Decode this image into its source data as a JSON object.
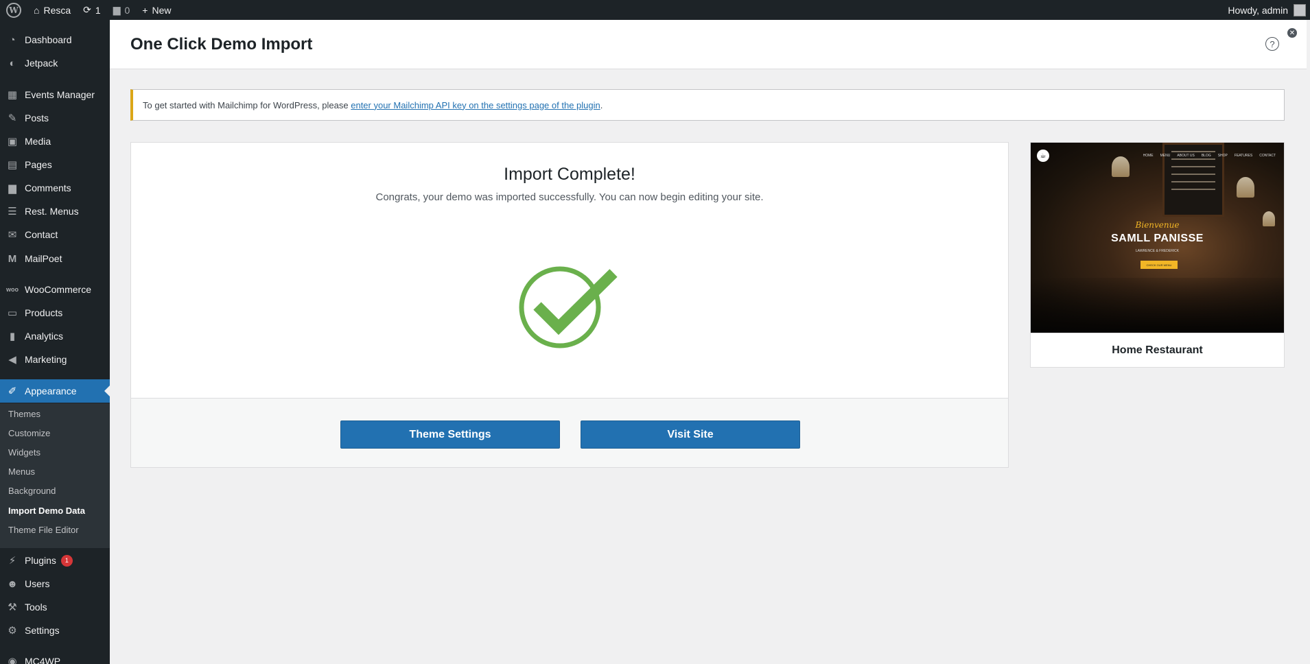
{
  "adminbar": {
    "site_name": "Resca",
    "updates_count": "1",
    "comments_count": "0",
    "new_label": "New",
    "greeting": "Howdy, admin"
  },
  "sidebar": {
    "items": [
      {
        "label": "Dashboard",
        "icon": "dashboard-icon"
      },
      {
        "label": "Jetpack",
        "icon": "jetpack-icon"
      },
      {
        "label": "Events Manager",
        "icon": "calendar-icon"
      },
      {
        "label": "Posts",
        "icon": "pin-icon"
      },
      {
        "label": "Media",
        "icon": "media-icon"
      },
      {
        "label": "Pages",
        "icon": "pages-icon"
      },
      {
        "label": "Comments",
        "icon": "comment-icon"
      },
      {
        "label": "Rest. Menus",
        "icon": "list-icon"
      },
      {
        "label": "Contact",
        "icon": "mail-icon"
      },
      {
        "label": "MailPoet",
        "icon": "mailpoet-icon"
      },
      {
        "label": "WooCommerce",
        "icon": "woo-icon"
      },
      {
        "label": "Products",
        "icon": "archive-icon"
      },
      {
        "label": "Analytics",
        "icon": "bar-chart-icon"
      },
      {
        "label": "Marketing",
        "icon": "megaphone-icon"
      },
      {
        "label": "Appearance",
        "icon": "brush-icon"
      },
      {
        "label": "Plugins",
        "icon": "plug-icon",
        "badge": "1"
      },
      {
        "label": "Users",
        "icon": "user-icon"
      },
      {
        "label": "Tools",
        "icon": "wrench-icon"
      },
      {
        "label": "Settings",
        "icon": "settings-icon"
      },
      {
        "label": "MC4WP",
        "icon": "mc4wp-icon"
      }
    ],
    "submenu": [
      "Themes",
      "Customize",
      "Widgets",
      "Menus",
      "Background",
      "Import Demo Data",
      "Theme File Editor"
    ]
  },
  "header": {
    "title": "One Click Demo Import"
  },
  "notice": {
    "text": "To get started with Mailchimp for WordPress, please ",
    "link": "enter your Mailchimp API key on the settings page of the plugin",
    "suffix": "."
  },
  "import": {
    "title": "Import Complete!",
    "subtitle": "Congrats, your demo was imported successfully. You can now begin editing your site.",
    "theme_settings_label": "Theme Settings",
    "visit_site_label": "Visit Site"
  },
  "preview": {
    "name": "Home Restaurant",
    "nav": [
      "HOME",
      "MENU",
      "ABOUT US",
      "BLOG",
      "SHOP",
      "FEATURES",
      "CONTACT"
    ],
    "script": "Bienvenue",
    "title": "SAMLL PANISSE",
    "tagline": "LAWRENCE & FREDERICK",
    "button": "CHECK OUR MENU"
  },
  "colors": {
    "accent": "#2271b1",
    "success": "#6ab04c",
    "notice_border": "#dba617"
  }
}
